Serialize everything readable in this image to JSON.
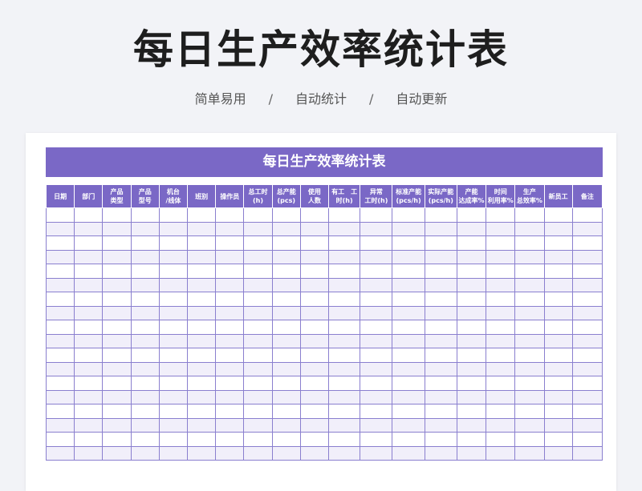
{
  "page": {
    "title": "每日生产效率统计表",
    "features": [
      "简单易用",
      "自动统计",
      "自动更新"
    ],
    "separator": "/"
  },
  "sheet": {
    "title": "每日生产效率统计表",
    "columns": [
      "日期",
      "部门",
      "产品\n类型",
      "产品\n型号",
      "机台\n/线体",
      "班别",
      "操作员",
      "总工时\n(h)",
      "总产能\n(pcs)",
      "使用\n人数",
      "有工　工\n时(h)",
      "异常\n工时(h)",
      "标准产能\n(pcs/h)",
      "实际产能\n(pcs/h)",
      "产能\n达成率%",
      "时间\n利用率%",
      "生产\n总效率%",
      "新员工",
      "备注"
    ],
    "rows": 18
  },
  "colors": {
    "accent": "#7a68c6",
    "grid_line": "#8a7fcf",
    "alt_row": "#f1effa",
    "background": "#f2f3f7"
  }
}
